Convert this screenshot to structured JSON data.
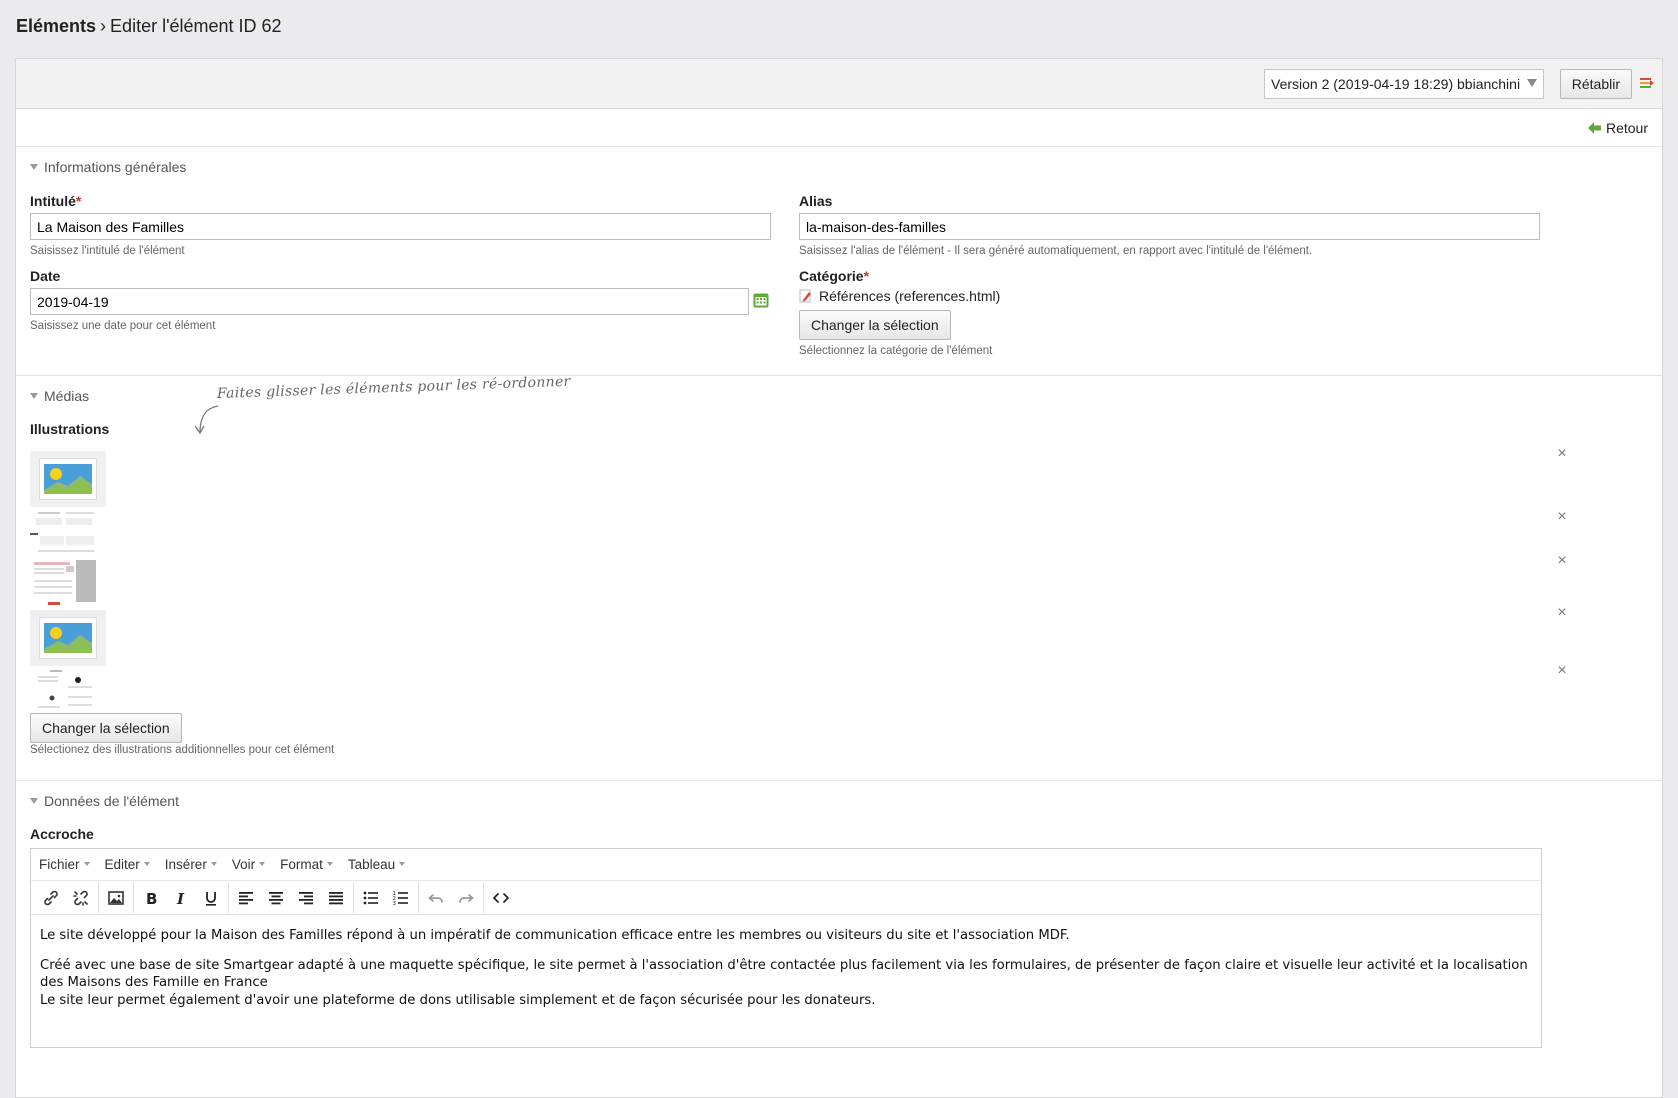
{
  "breadcrumb": {
    "root": "Eléments",
    "separator": "›",
    "current": "Editer l'élément ID 62"
  },
  "toolbar": {
    "version_value": "Version 2 (2019-04-19 18:29) bbianchini",
    "restore_label": "Rétablir"
  },
  "back": {
    "label": "Retour"
  },
  "general": {
    "title": "Informations générales",
    "intitule": {
      "label": "Intitulé",
      "required": "*",
      "value": "La Maison des Familles",
      "help": "Saisissez l'intitulé de l'élément"
    },
    "alias": {
      "label": "Alias",
      "value": "la-maison-des-familles",
      "help": "Saisissez l'alias de l'élément - Il sera généré automatiquement, en rapport avec l'intitulé de l'élément."
    },
    "date": {
      "label": "Date",
      "value": "2019-04-19",
      "help": "Saisissez une date pour cet élément"
    },
    "category": {
      "label": "Catégorie",
      "required": "*",
      "value": "Références (references.html)",
      "change_label": "Changer la sélection",
      "help": "Sélectionnez la catégorie de l'élément"
    }
  },
  "medias": {
    "title": "Médias",
    "drag_hint": "Faites glisser les éléments pour les ré-ordonner",
    "illustrations_label": "Illustrations",
    "remove_symbol": "×",
    "change_label": "Changer la sélection",
    "help": "Sélectionez des illustrations additionnelles pour cet élément"
  },
  "data_section": {
    "title": "Données de l'élément",
    "accroche_label": "Accroche",
    "menu": [
      "Fichier",
      "Editer",
      "Insérer",
      "Voir",
      "Format",
      "Tableau"
    ],
    "paragraphs": [
      "Le site développé pour la Maison des Familles répond à un impératif de communication efficace entre les membres ou visiteurs du site et l'association MDF.",
      "Créé avec une base de site Smartgear adapté à une maquette spécifique, le site permet à l'association d'être contactée plus facilement via les formulaires, de présenter de façon claire et visuelle leur activité et la localisation des Maisons des Famille en France",
      "Le site leur permet également d'avoir une plateforme de dons utilisable simplement et de façon sécurisée pour les donateurs."
    ]
  },
  "colors": {
    "required": "#c0392b",
    "back_arrow": "#5fa83a",
    "calendar": "#5fa83a"
  }
}
